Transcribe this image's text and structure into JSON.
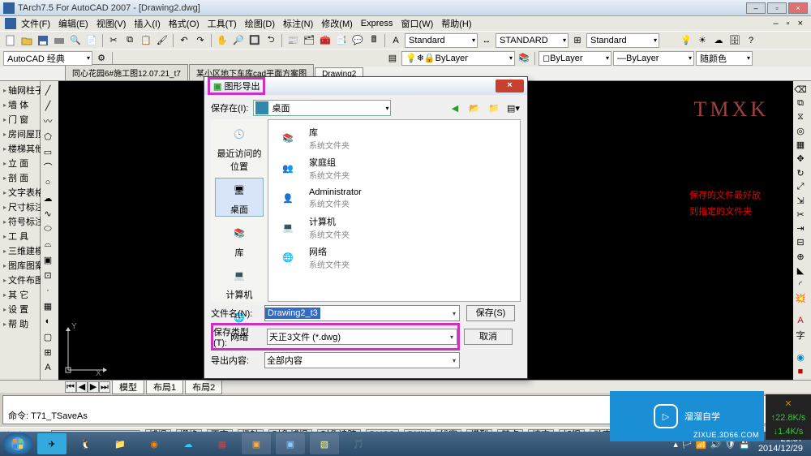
{
  "app": {
    "title": "TArch7.5 For AutoCAD 2007 - [Drawing2.dwg]"
  },
  "menu": [
    "文件(F)",
    "编辑(E)",
    "视图(V)",
    "插入(I)",
    "格式(O)",
    "工具(T)",
    "绘图(D)",
    "标注(N)",
    "修改(M)",
    "Express",
    "窗口(W)",
    "帮助(H)"
  ],
  "toolbar2": {
    "workspace": "AutoCAD 经典"
  },
  "toolbar3": {
    "style1": "Standard",
    "style2": "STANDARD",
    "style3": "Standard",
    "layer": "ByLayer",
    "color": "ByLayer",
    "ltype": "ByLayer",
    "lweight": "随颜色"
  },
  "tabs": [
    "同心花园6#施工图12.07.21_t7",
    "某小区地下车库cad平面方案图",
    "Drawing2"
  ],
  "leftpanel_items": [
    "轴网柱子",
    "墙 体",
    "门 窗",
    "房间屋顶",
    "楼梯其他",
    "立 面",
    "剖 面",
    "文字表格",
    "尺寸标注",
    "符号标注",
    "工 具",
    "三维建模",
    "图库图案",
    "文件布图",
    "其 它",
    "设 置",
    "帮 助"
  ],
  "watermark": "TMXK",
  "annotation": {
    "line1": "保存的文件最好放",
    "line2": "到指定的文件夹"
  },
  "dialog": {
    "title": "图形导出",
    "save_in_label": "保存在(I):",
    "save_in_value": "桌面",
    "places": [
      {
        "label": "最近访问的位置"
      },
      {
        "label": "桌面"
      },
      {
        "label": "库"
      },
      {
        "label": "计算机"
      },
      {
        "label": "网络"
      }
    ],
    "filelist": [
      {
        "name": "库",
        "sub": "系统文件夹",
        "kind": "lib"
      },
      {
        "name": "家庭组",
        "sub": "系统文件夹",
        "kind": "home"
      },
      {
        "name": "Administrator",
        "sub": "系统文件夹",
        "kind": "user"
      },
      {
        "name": "计算机",
        "sub": "系统文件夹",
        "kind": "pc"
      },
      {
        "name": "网络",
        "sub": "系统文件夹",
        "kind": "net"
      }
    ],
    "filename_label": "文件名(N):",
    "filename_value": "Drawing2_t3",
    "filetype_label": "保存类型(T):",
    "filetype_value": "天正3文件 (*.dwg)",
    "export_label": "导出内容:",
    "export_value": "全部内容",
    "btn_save": "保存(S)",
    "btn_cancel": "取消"
  },
  "model_tabs": [
    "模型",
    "布局1",
    "布局2"
  ],
  "cmd": {
    "prompt": "命令:",
    "text": "T71_TSaveAs"
  },
  "status": {
    "scale_label": "比例 1:100",
    "coords": "85095, 120537, 0",
    "btns": [
      "捕捉",
      "栅格",
      "正交",
      "极轴",
      "对象捕捉",
      "对象追踪",
      "DUCS",
      "DYN",
      "线宽",
      "模型",
      "基点",
      "填充",
      "加粗",
      "动态标注"
    ]
  },
  "tray": {
    "time": "21:57",
    "date": "2014/12/29"
  },
  "logo": {
    "text": "溜溜自学",
    "url": "ZIXUE.3D66.COM"
  },
  "badge": {
    "l1": "22.8K/s",
    "l2": "1.4K/s"
  }
}
